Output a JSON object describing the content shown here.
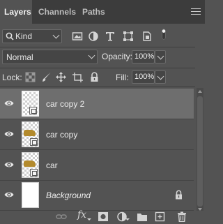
{
  "tabs": [
    {
      "label": "Layers",
      "active": true
    },
    {
      "label": "Channels",
      "active": false
    },
    {
      "label": "Paths",
      "active": false
    }
  ],
  "panel_menu_icon": "hamburger-menu-icon",
  "filter": {
    "kind_label": "Kind",
    "icons": [
      "image-filter-icon",
      "adjustment-filter-icon",
      "type-filter-icon",
      "shape-filter-icon",
      "smart-object-filter-icon",
      "filter-toggle-icon"
    ]
  },
  "blend": {
    "mode": "Normal",
    "opacity_label": "Opacity:",
    "opacity_value": "100%"
  },
  "lock": {
    "label": "Lock:",
    "icons": [
      "lock-transparent-pixels-icon",
      "lock-image-pixels-icon",
      "lock-position-icon",
      "lock-artboard-icon",
      "lock-all-icon"
    ],
    "fill_label": "Fill:",
    "fill_value": "100%"
  },
  "layers": [
    {
      "name": "car copy 2",
      "selected": true,
      "visible": true,
      "italic": false,
      "locked": false
    },
    {
      "name": "car copy",
      "selected": false,
      "visible": true,
      "italic": false,
      "locked": false
    },
    {
      "name": "car",
      "selected": false,
      "visible": true,
      "italic": false,
      "locked": false
    },
    {
      "name": "Background",
      "selected": false,
      "visible": true,
      "italic": true,
      "locked": true
    }
  ],
  "bottom_toolbar": {
    "fx_label": "fx",
    "icons": [
      "link-layers-icon",
      "layer-style-icon",
      "add-mask-icon",
      "adjustment-layer-icon",
      "new-group-icon",
      "new-layer-icon",
      "delete-layer-icon"
    ]
  },
  "colors": {
    "panel_bg": "#535353",
    "tabbar_bg": "#3c3c3c",
    "selected_row": "#6e6e6e",
    "text": "#e6e6e6"
  }
}
